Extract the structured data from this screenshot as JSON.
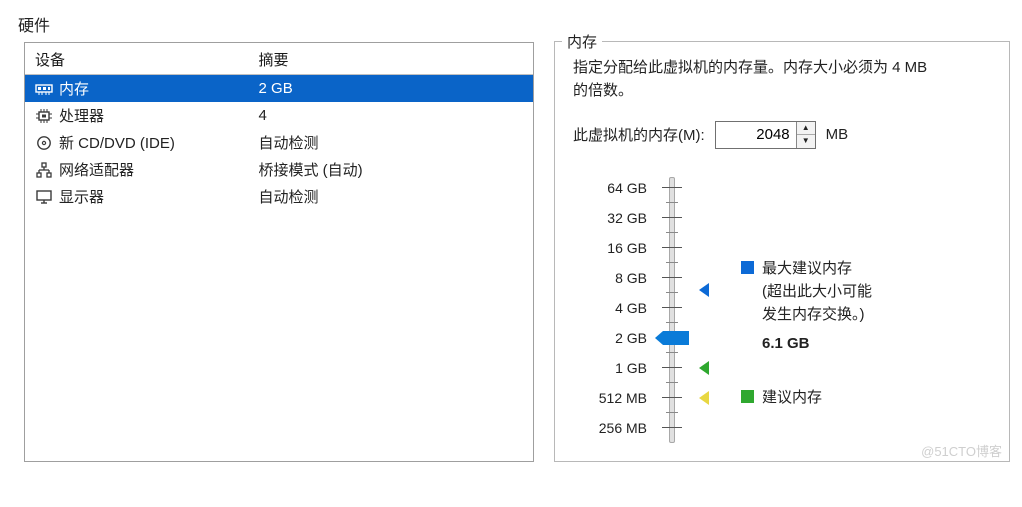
{
  "page": {
    "title": "硬件"
  },
  "device_table": {
    "headers": {
      "device": "设备",
      "summary": "摘要"
    },
    "rows": [
      {
        "icon": "memory",
        "name": "内存",
        "summary": "2 GB",
        "selected": true
      },
      {
        "icon": "cpu",
        "name": "处理器",
        "summary": "4",
        "selected": false
      },
      {
        "icon": "disc",
        "name": "新 CD/DVD (IDE)",
        "summary": "自动检测",
        "selected": false
      },
      {
        "icon": "nic",
        "name": "网络适配器",
        "summary": "桥接模式 (自动)",
        "selected": false
      },
      {
        "icon": "display",
        "name": "显示器",
        "summary": "自动检测",
        "selected": false
      }
    ]
  },
  "memory_panel": {
    "legend": "内存",
    "description_line1": "指定分配给此虚拟机的内存量。内存大小必须为 4 MB",
    "description_line2": "的倍数。",
    "input_label": "此虚拟机的内存(M):",
    "input_value": "2048",
    "unit": "MB",
    "ticks": [
      "64 GB",
      "32 GB",
      "16 GB",
      "8 GB",
      "4 GB",
      "2 GB",
      "1 GB",
      "512 MB",
      "256 MB"
    ],
    "selected_tick_index": 5,
    "max_annotation": {
      "title": "最大建议内存",
      "note_line1": "(超出此大小可能",
      "note_line2": "发生内存交换。)",
      "value": "6.1 GB",
      "pointer_tick_index": 3.4
    },
    "rec_annotation": {
      "title": "建议内存",
      "pointer_tick_index_green": 6,
      "pointer_tick_index_yellow": 7
    }
  },
  "watermark": "@51CTO博客"
}
